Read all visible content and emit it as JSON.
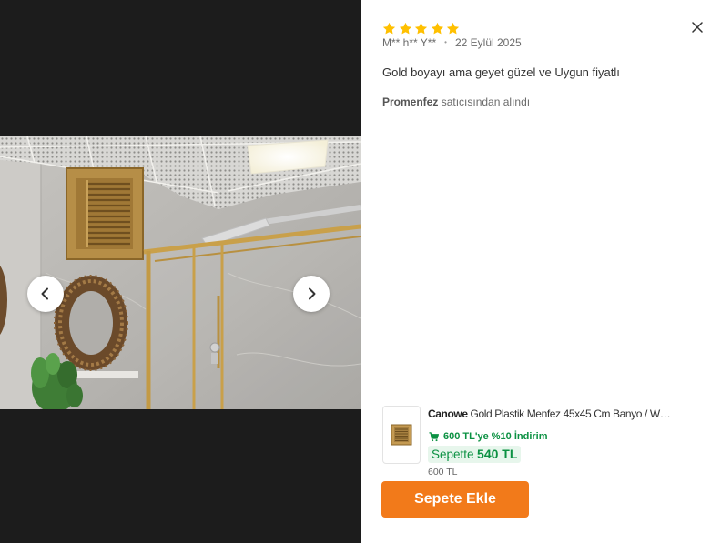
{
  "review": {
    "rating": 5,
    "rating_max": 5,
    "author": "M** h** Y**",
    "separator": "•",
    "date": "22 Eylül 2025",
    "text": "Gold boyayı ama geyet güzel ve Uygun fiyatlı",
    "seller_name": "Promenfez",
    "seller_suffix": " satıcısından alındı"
  },
  "gallery": {
    "prev_icon": "chevron-left-icon",
    "next_icon": "chevron-right-icon"
  },
  "close_icon": "close-icon",
  "product": {
    "brand": "Canowe",
    "name": " Gold Plastik Menfez 45x45 Cm Banyo / W…",
    "promo_icon": "cart-icon",
    "promo_text": "600 TL'ye %10 İndirim",
    "basket_label": "Sepette",
    "basket_price": "540 TL",
    "original_price": "600 TL",
    "add_to_cart_label": "Sepete Ekle"
  },
  "theme": {
    "star": "#ffc000",
    "accent": "#f27a1a",
    "promo_green": "#0b9142",
    "badge_bg": "#e7f6ec"
  }
}
